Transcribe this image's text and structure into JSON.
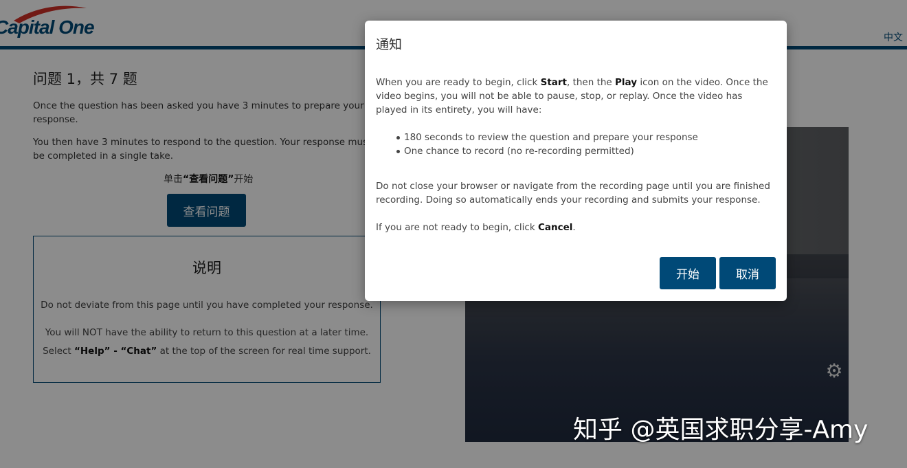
{
  "header": {
    "logo_text": "Capital One",
    "language_link": "中文"
  },
  "question": {
    "title": "问题 1，共 7 题",
    "para1": "Once the question has been asked you have 3 minutes to prepare your response.",
    "para2": "You then have 3 minutes to respond to the question. Your response must be completed in a single take.",
    "view_hint_prefix": "单击",
    "view_hint_bold": "“查看问题”",
    "view_hint_suffix": "开始",
    "view_button": "查看问题"
  },
  "instructions": {
    "title": "说明",
    "line1": "Do not deviate from this page until you have completed your response.",
    "line2": "You will NOT have the ability to return to this question at a later time.",
    "line3_prefix": "Select ",
    "line3_bold": "“Help” - “Chat”",
    "line3_suffix": " at the top of the screen for real time support."
  },
  "video": {
    "settings_icon": "gear-icon"
  },
  "modal": {
    "title": "通知",
    "p1_a": "When you are ready to begin, click ",
    "p1_b": "Start",
    "p1_c": ", then the ",
    "p1_d": "Play",
    "p1_e": " icon on the video. Once the video begins, you will not be able to pause, stop, or replay. Once the video has played in its entirety, you will have:",
    "bullets": [
      "180 seconds to review the question and prepare your response",
      "One chance to record (no re-recording permitted)"
    ],
    "p2": "Do not close your browser or navigate from the recording page until you are finished recording. Doing so automatically ends your recording and submits your response.",
    "p3_a": "If you are not ready to begin, click ",
    "p3_b": "Cancel",
    "p3_c": ".",
    "start_button": "开始",
    "cancel_button": "取消"
  },
  "watermark": "知乎 @英国求职分享-Amy",
  "colors": {
    "brand_blue": "#004977",
    "brand_red": "#d03027"
  }
}
